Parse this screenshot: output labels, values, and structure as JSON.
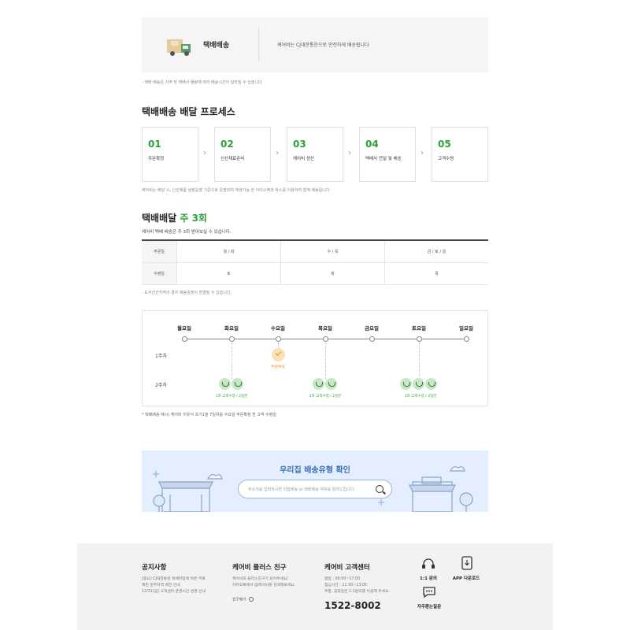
{
  "hero": {
    "title": "택배배송",
    "description": "케어비는 CJ대한통운으로 안전하게 배송됩니다",
    "icon": "delivery-truck-icon"
  },
  "hero_note": "- 택배 배송은 지역 및 택배사 물량에 따라 배송시간이 달라질 수 있습니다",
  "process": {
    "title": "택배배송 배달 프로세스",
    "steps": [
      {
        "num": "01",
        "label": "주문확정"
      },
      {
        "num": "02",
        "label": "신선재료준비"
      },
      {
        "num": "03",
        "label": "케어비 생산"
      },
      {
        "num": "04",
        "label": "택배사 전달 및 배송"
      },
      {
        "num": "05",
        "label": "고객수령"
      }
    ],
    "note": "케어비는 배달 시, 신선제품 냉장운영 기준으로 운영되며 재생가능 한 아이스팩과 박스를 이용하여 함께 배송됩니다"
  },
  "schedule": {
    "title_prefix": "택배배달",
    "title_accent": "주 3회",
    "subtitle": "케어비 택배 배송은 주 3회 받아보실 수 있습니다.",
    "table": {
      "headers": [
        "주문일",
        "수령일"
      ],
      "order_days": [
        "월 / 화",
        "수 / 목",
        "금 / 토 / 일"
      ],
      "receive_days": [
        "토",
        "화",
        "목"
      ]
    },
    "note": "- 도서산간지역의 경우 배송일정이 변경될 수 있습니다."
  },
  "timeline": {
    "days": [
      "월요일",
      "화요일",
      "수요일",
      "목요일",
      "금요일",
      "토요일",
      "일요일"
    ],
    "weeks": [
      "1주차",
      "2주차"
    ],
    "order_label": "주문확정",
    "deliveries": [
      "1차 고객수령 / 2일분",
      "2차 고객수령 / 2일분",
      "3차 고객수령 / 3일분"
    ],
    "note": "* 택배배송 예시) 케어비 이유식 초기1을 7일치를 수요일 주문확정 한 고객 수령일"
  },
  "banner": {
    "title": "우리집 배송유형 확인",
    "placeholder": "주소지를 입력하시면 직접배송 or 택배배송 여부를 알려드립니다."
  },
  "footer": {
    "notice": {
      "title": "공지사항",
      "lines": [
        "[중요] CJ대한통운 택배파업에 따른 무료",
        "제된 일부지역 배한 안내",
        "12/31(금) 고객센터 운영시간 변경 안내"
      ]
    },
    "plus_friend": {
      "title": "케어비 플러스 친구",
      "lines": [
        "케어비와 플러스친구가 되어주세요!",
        "카카오톡에서 @케어비를 검색해보세요."
      ],
      "link": "친구맺기"
    },
    "customer_center": {
      "title": "케어비 고객센터",
      "lines": [
        "평일 : 09:00~17:00",
        "점심시간 : 11:30~13:00",
        "주말, 공휴일은 1:1문의를 이용해 주세요."
      ],
      "phone": "1522-8002"
    },
    "quick_links": [
      "1:1 문의",
      "APP 다운로드",
      "자주묻는질문"
    ]
  },
  "colors": {
    "accent": "#2ca135",
    "banner_bg": "#e3efff",
    "footer_bg": "#f2f2f2"
  }
}
